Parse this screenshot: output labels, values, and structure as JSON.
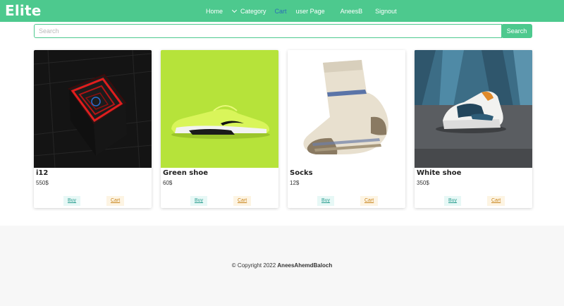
{
  "brand": "Elite",
  "nav": {
    "home": "Home",
    "category": "Category",
    "cart": "Cart",
    "user_page": "user Page",
    "username": "AneesB",
    "signout": "Signout"
  },
  "search": {
    "placeholder": "Search",
    "value": "",
    "button_label": "Search"
  },
  "products": [
    {
      "name": "i12",
      "price": "550$",
      "buy_label": "Buy",
      "cart_label": "Cart"
    },
    {
      "name": "Green shoe",
      "price": "60$",
      "buy_label": "Buy",
      "cart_label": "Cart"
    },
    {
      "name": "Socks",
      "price": "12$",
      "buy_label": "Buy",
      "cart_label": "Cart"
    },
    {
      "name": "White shoe",
      "price": "350$",
      "buy_label": "Buy",
      "cart_label": "Cart"
    }
  ],
  "footer": {
    "copyright": "© Copyright 2022",
    "author": "AneesAhemdBaloch"
  },
  "colors": {
    "accent": "#4dc98e",
    "nav_cart": "#2b6fb6",
    "buy": "#2a9d8f",
    "cart": "#c9861e",
    "footer_bg": "#f7f7f7"
  }
}
